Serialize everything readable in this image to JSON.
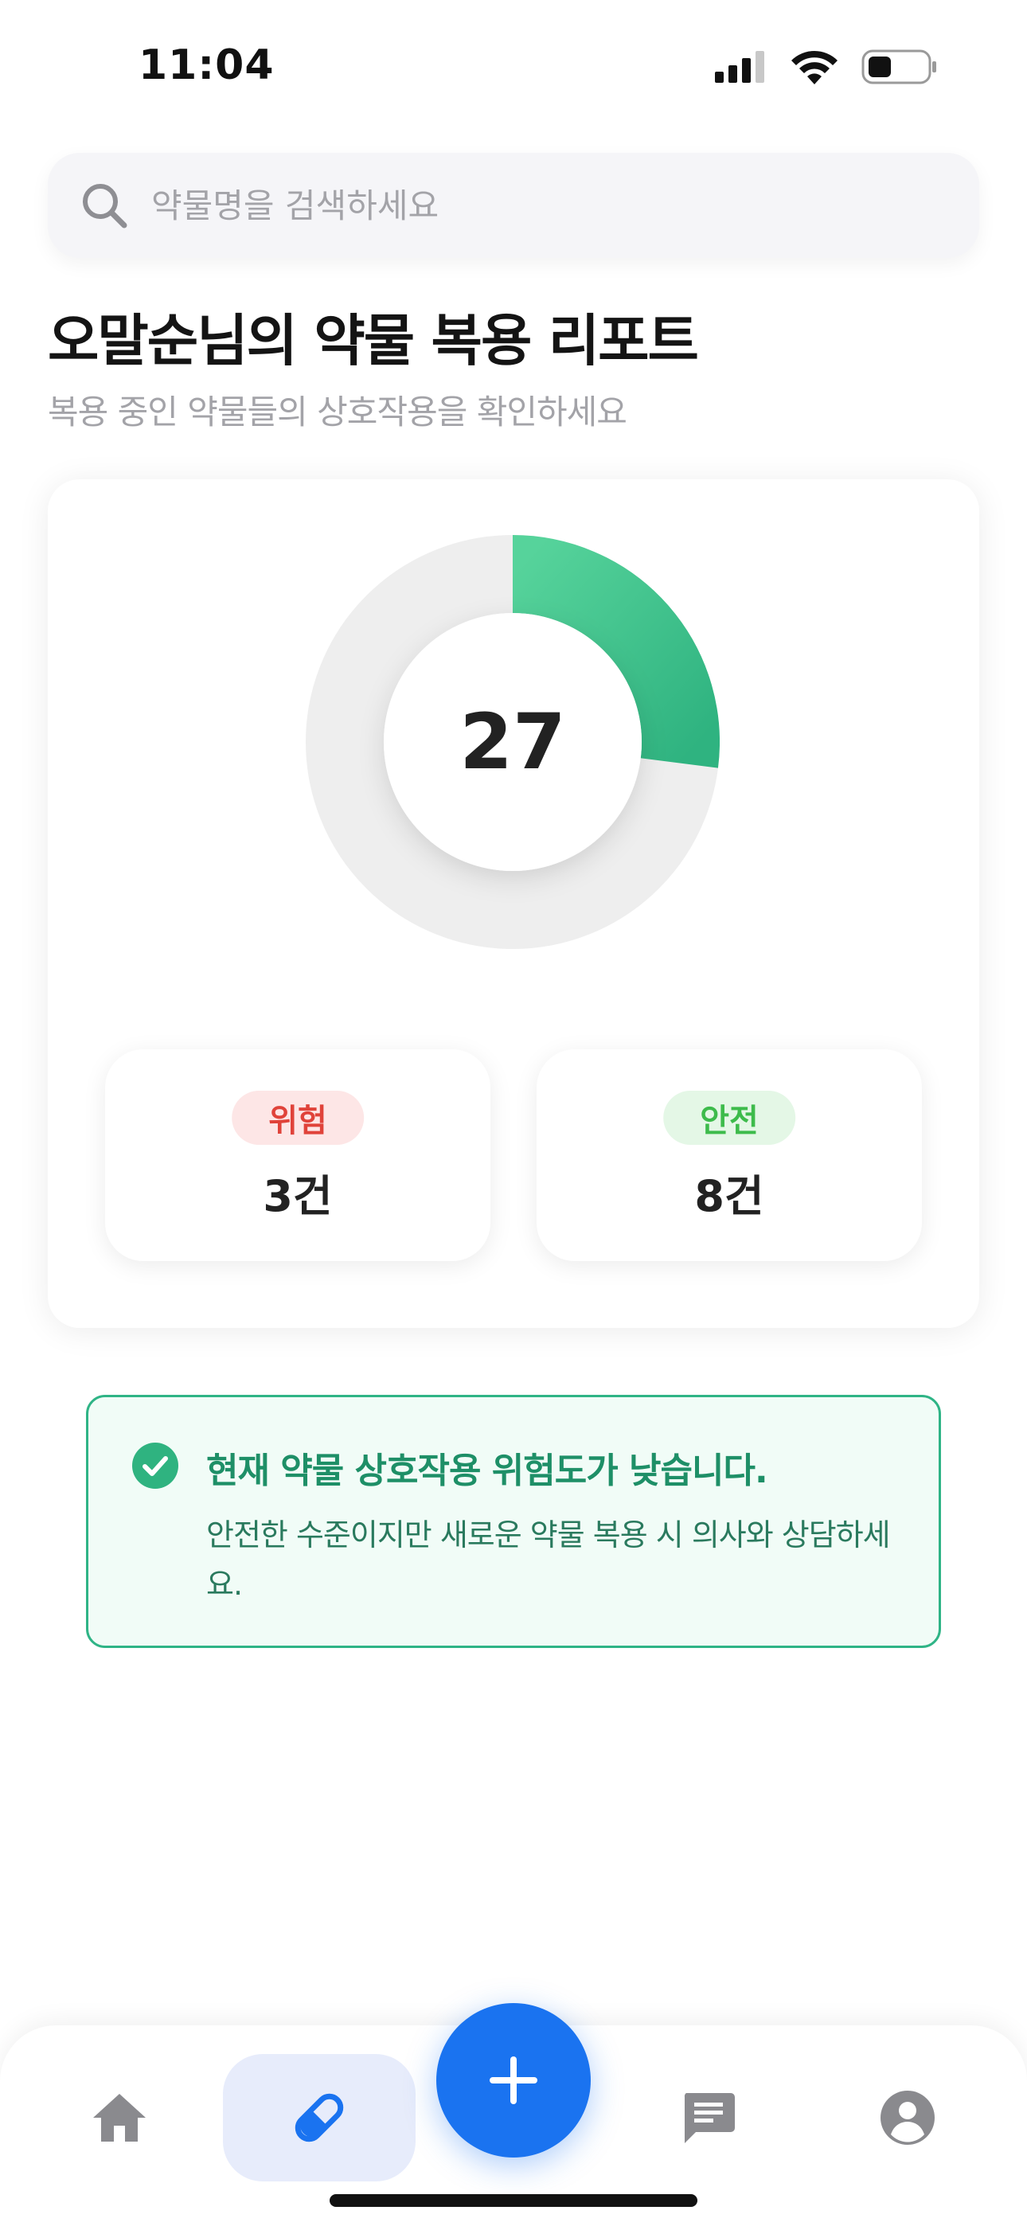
{
  "status_bar": {
    "time": "11:04"
  },
  "search": {
    "placeholder": "약물명을 검색하세요",
    "value": ""
  },
  "header": {
    "title": "오말순님의 약물 복용 리포트",
    "subtitle": "복용 중인 약물들의 상호작용을 확인하세요"
  },
  "report": {
    "score": "27",
    "score_fraction": 0.27,
    "accent_color": "#3cc48d",
    "track_color": "#eeeeee",
    "danger": {
      "label": "위험",
      "count": "3건",
      "color": "#e0433a"
    },
    "safe": {
      "label": "안전",
      "count": "8건",
      "color": "#3dbb4b"
    }
  },
  "notice": {
    "icon": "check-circle-icon",
    "title": "현재 약물 상호작용 위험도가 낮습니다.",
    "body": "안전한 수준이지만 새로운 약물 복용 시 의사와 상담하세요.",
    "color": "#1e8f67"
  },
  "tab_bar": {
    "items": [
      {
        "icon": "home-icon",
        "active": false
      },
      {
        "icon": "pill-icon",
        "active": true
      },
      {
        "icon": "chat-icon",
        "active": false
      },
      {
        "icon": "profile-icon",
        "active": false
      }
    ],
    "fab_icon": "plus-icon",
    "accent": "#1a73f0"
  }
}
